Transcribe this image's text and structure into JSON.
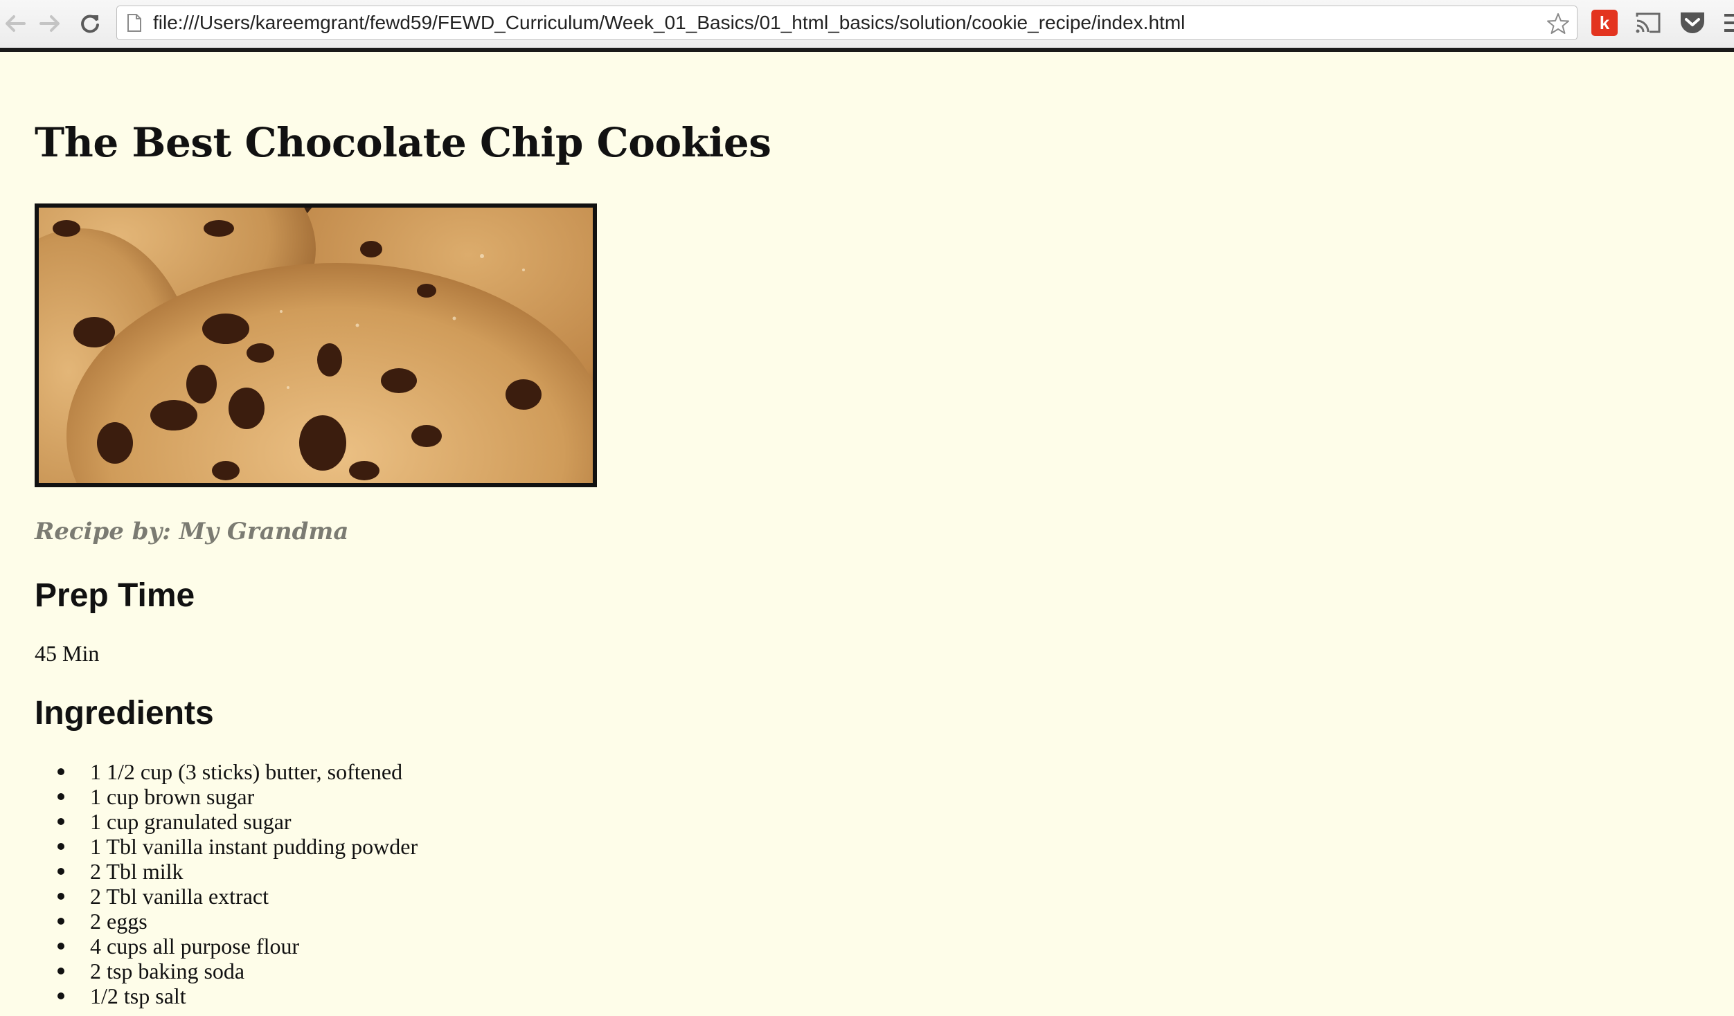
{
  "browser": {
    "url": "file:///Users/kareemgrant/fewd59/FEWD_Curriculum/Week_01_Basics/01_html_basics/solution/cookie_recipe/index.html",
    "extension_badge": "k",
    "icons": [
      "back-icon",
      "forward-icon",
      "reload-icon",
      "page-icon",
      "star-icon",
      "cast-icon",
      "pocket-icon",
      "menu-icon"
    ]
  },
  "recipe": {
    "title": "The Best Chocolate Chip Cookies",
    "byline": "Recipe by: My Grandma",
    "prep_heading": "Prep Time",
    "prep_value": "45 Min",
    "ingredients_heading": "Ingredients",
    "ingredients": [
      "1 1/2 cup (3 sticks) butter, softened",
      "1 cup brown sugar",
      "1 cup granulated sugar",
      "1 Tbl vanilla instant pudding powder",
      "2 Tbl milk",
      "2 Tbl vanilla extract",
      "2 eggs",
      "4 cups all purpose flour",
      "2 tsp baking soda",
      "1/2 tsp salt"
    ]
  },
  "colors": {
    "page_background": "#fefde9",
    "byline": "#7b7b72",
    "extension_badge": "#e3341f"
  }
}
